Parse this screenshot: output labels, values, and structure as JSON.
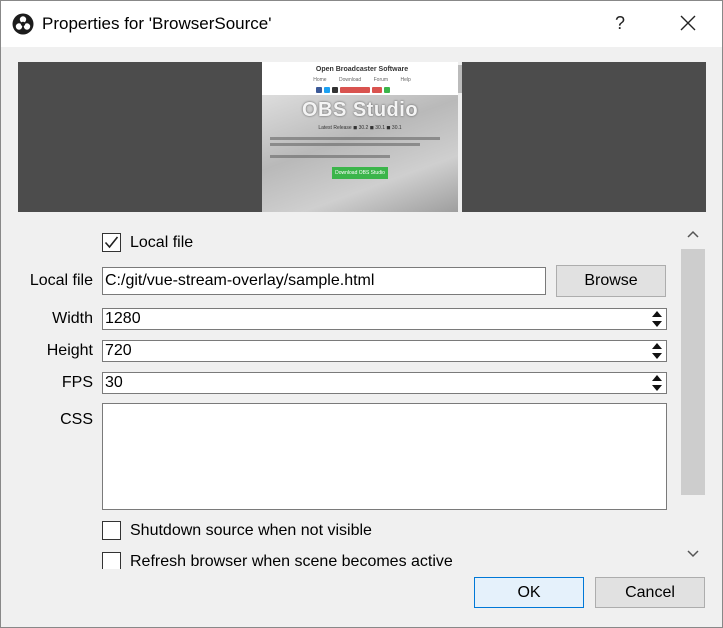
{
  "window": {
    "title": "Properties for 'BrowserSource'",
    "app_icon": "obs-icon",
    "help_label": "?",
    "close_icon": "close-icon"
  },
  "preview": {
    "site_title": "Open Broadcaster Software",
    "nav": [
      "Home",
      "Download",
      "Forum",
      "Help"
    ],
    "brand": "OBS Studio",
    "release_meta": "Latest Release  ◼ 30.2  ◼ 30.1  ◼ 30.1",
    "download_label": "Download OBS Studio"
  },
  "form": {
    "local_file_checkbox": {
      "label": "Local file",
      "checked": true
    },
    "local_file": {
      "label": "Local file",
      "value": "C:/git/vue-stream-overlay/sample.html",
      "browse_label": "Browse"
    },
    "width": {
      "label": "Width",
      "value": "1280"
    },
    "height": {
      "label": "Height",
      "value": "720"
    },
    "fps": {
      "label": "FPS",
      "value": "30"
    },
    "css": {
      "label": "CSS",
      "value": ""
    },
    "shutdown_checkbox": {
      "label": "Shutdown source when not visible",
      "checked": false
    },
    "refresh_checkbox": {
      "label": "Refresh browser when scene becomes active",
      "checked": false
    }
  },
  "footer": {
    "ok_label": "OK",
    "cancel_label": "Cancel"
  },
  "colors": {
    "accent": "#0078d7",
    "preview_bg": "#4c4c4c",
    "download_green": "#3bb54a"
  }
}
